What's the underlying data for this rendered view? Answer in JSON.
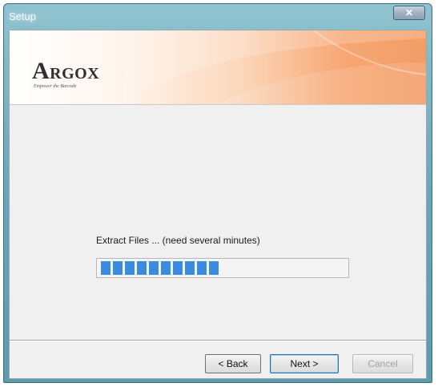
{
  "window": {
    "title": "Setup",
    "close_glyph": "✕"
  },
  "banner": {
    "logo": "ARGOX",
    "tagline": "Empower the Barcode"
  },
  "progress": {
    "label": "Extract Files ... (need several minutes)",
    "blocks_filled": 10,
    "fraction": 0.55,
    "color": "#3b8bde"
  },
  "buttons": {
    "back": "< Back",
    "next": "Next >",
    "cancel": "Cancel"
  },
  "colors": {
    "frame": "#6aa6b7",
    "banner_accent": "#f29d66",
    "dialog_bg": "#f0f0f0"
  }
}
